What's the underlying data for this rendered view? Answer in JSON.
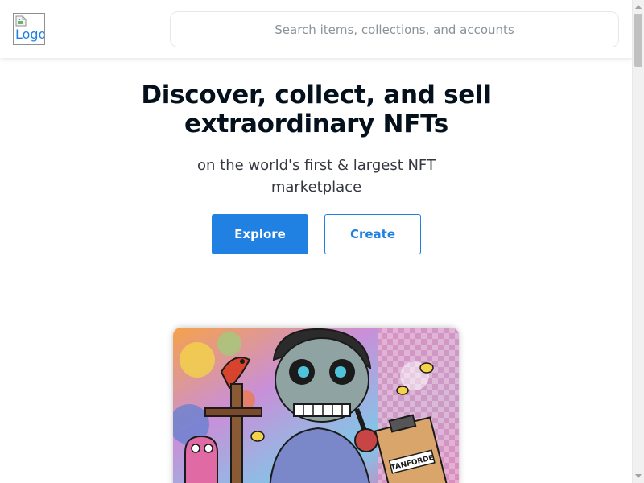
{
  "header": {
    "logo_alt": "Logo",
    "search": {
      "placeholder": "Search items, collections, and accounts",
      "value": ""
    }
  },
  "hero": {
    "title_line1": "Discover, collect, and sell",
    "title_line2": "extraordinary NFTs",
    "subtitle_line1": "on the world's first & largest NFT",
    "subtitle_line2": "marketplace",
    "explore_label": "Explore",
    "create_label": "Create"
  },
  "featured": {
    "artwork_text": "TANFORDE"
  },
  "colors": {
    "accent": "#2081e2",
    "text_primary": "#04111d",
    "text_secondary": "#353840",
    "placeholder": "#8a939b"
  }
}
